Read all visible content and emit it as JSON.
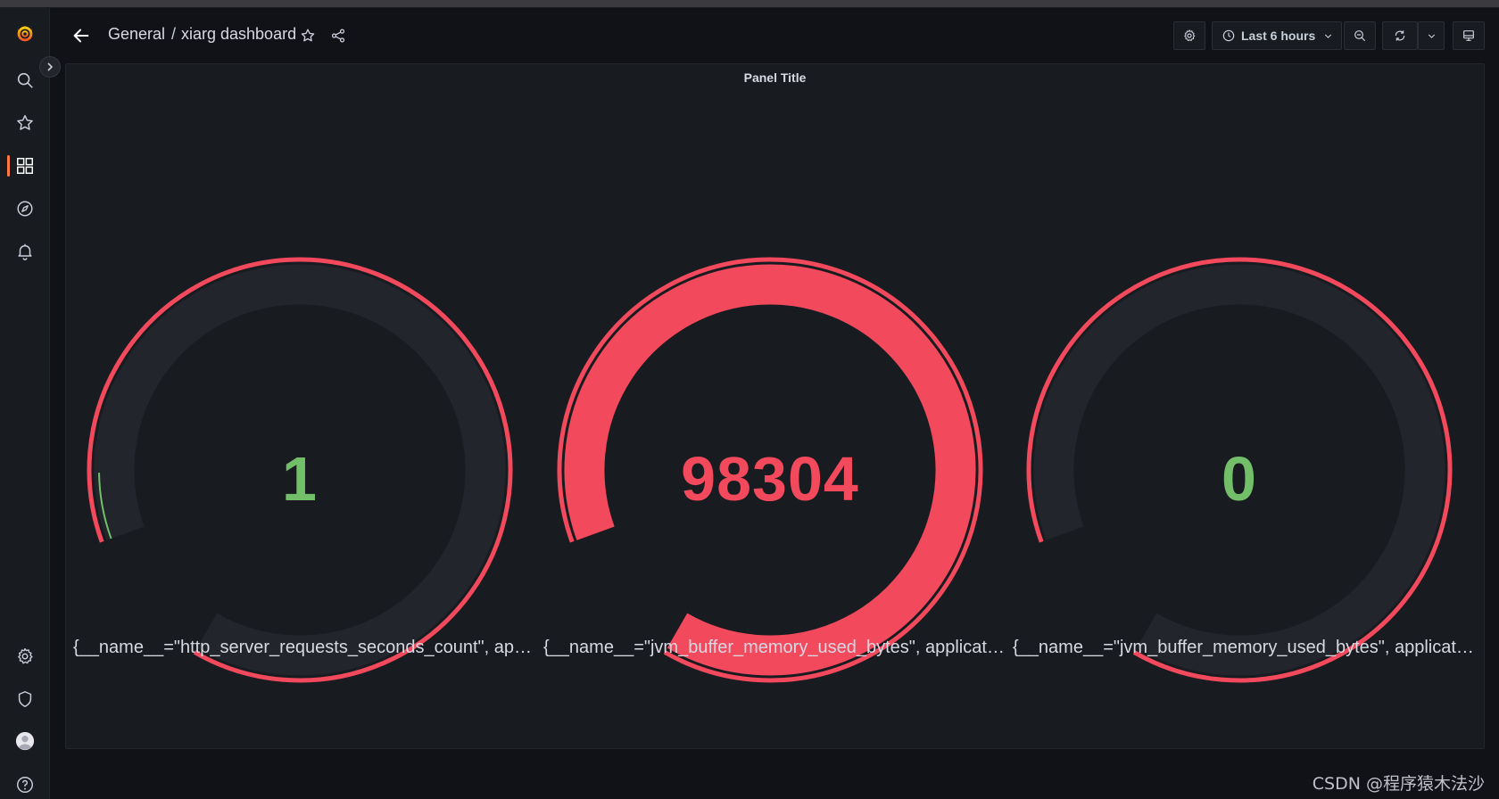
{
  "header": {
    "breadcrumb_folder": "General",
    "breadcrumb_separator": "/",
    "dashboard_title": "xiarg dashboard",
    "time_range": "Last 6 hours"
  },
  "sidebar": {
    "items": [
      {
        "name": "search",
        "icon": "search-icon"
      },
      {
        "name": "starred",
        "icon": "star-icon"
      },
      {
        "name": "dashboards",
        "icon": "apps-icon",
        "active": true
      },
      {
        "name": "explore",
        "icon": "compass-icon"
      },
      {
        "name": "alerting",
        "icon": "bell-icon"
      },
      {
        "name": "configuration",
        "icon": "gear-icon"
      },
      {
        "name": "server-admin",
        "icon": "shield-icon"
      },
      {
        "name": "profile",
        "icon": "avatar"
      },
      {
        "name": "help",
        "icon": "question-icon"
      }
    ]
  },
  "panel": {
    "title": "Panel Title",
    "gauges": [
      {
        "value": "1",
        "label": "{__name__=\"http_server_requests_seconds_count\", appl…",
        "value_color": "#73bf69",
        "fill": 0.01
      },
      {
        "value": "98304",
        "label": "{__name__=\"jvm_buffer_memory_used_bytes\", applicati…",
        "value_color": "#f2495c",
        "fill": 1.0
      },
      {
        "value": "0",
        "label": "{__name__=\"jvm_buffer_memory_used_bytes\", applicati…",
        "value_color": "#73bf69",
        "fill": 0.0
      }
    ]
  },
  "colors": {
    "threshold_red": "#f2495c",
    "threshold_green": "#73bf69",
    "gauge_track": "#22252b"
  },
  "watermark": "CSDN @程序猿木法沙"
}
